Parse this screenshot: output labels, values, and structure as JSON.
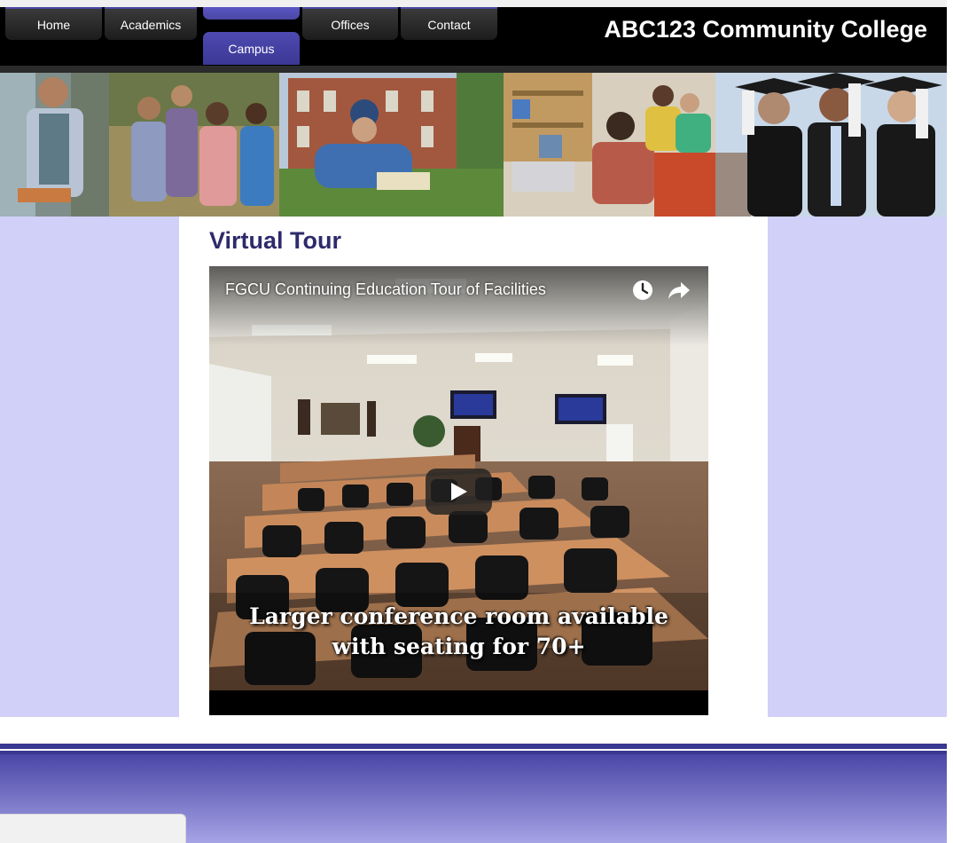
{
  "site": {
    "title": "ABC123 Community College"
  },
  "nav": {
    "items": [
      {
        "label": "Home"
      },
      {
        "label": "Academics"
      },
      {
        "label": "Campus"
      },
      {
        "label": "Offices"
      },
      {
        "label": "Contact"
      }
    ],
    "active": "Campus"
  },
  "main": {
    "heading": "Virtual Tour",
    "video": {
      "title": "FGCU Continuing Education Tour of Facilities",
      "caption_line1": "Larger conference room available",
      "caption_line2": "with seating for 70+",
      "icons": [
        "watch-later-icon",
        "share-icon",
        "play-icon"
      ]
    }
  },
  "colors": {
    "accent": "#4a47a3",
    "side_panel": "#d0d0f8",
    "heading": "#2e2a6b",
    "header_bg": "#000000"
  }
}
